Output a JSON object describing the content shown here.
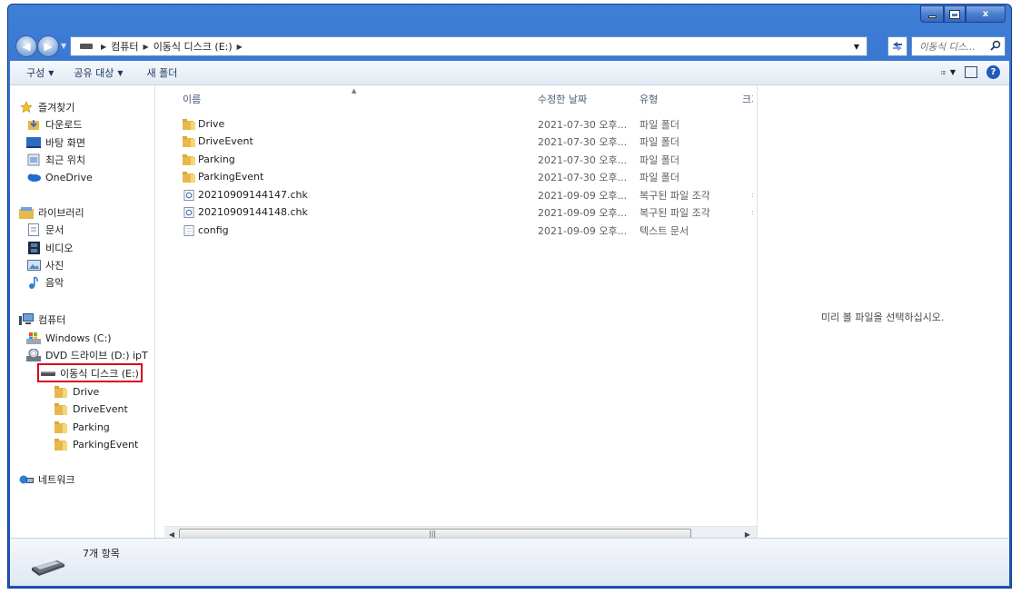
{
  "window": {
    "caption_minimize": "–",
    "caption_close": "x"
  },
  "address": {
    "crumbs": [
      "컴퓨터",
      "이동식 디스크 (E:)"
    ],
    "search_placeholder": "이동식 디스...",
    "refresh_icon": "refresh-icon"
  },
  "toolbar": {
    "organize": "구성",
    "share": "공유 대상",
    "new_folder": "새 폴더"
  },
  "nav": {
    "favorites": "즐겨찾기",
    "downloads": "다운로드",
    "desktop": "바탕 화면",
    "recent": "최근 위치",
    "onedrive": "OneDrive",
    "libraries": "라이브러리",
    "documents": "문서",
    "videos": "비디오",
    "pictures": "사진",
    "music": "음악",
    "computer": "컴퓨터",
    "windows_c": "Windows (C:)",
    "dvd_d": "DVD 드라이브 (D:) ipT",
    "removable_e": "이동식 디스크 (E:)",
    "sub": [
      "Drive",
      "DriveEvent",
      "Parking",
      "ParkingEvent"
    ],
    "network": "네트워크"
  },
  "columns": {
    "name": "이름",
    "modified": "수정한 날짜",
    "type": "유형",
    "size": "크기"
  },
  "files": [
    {
      "name": "Drive",
      "date": "2021-07-30 오후...",
      "type": "파일 폴더",
      "icon": "folder-icon"
    },
    {
      "name": "DriveEvent",
      "date": "2021-07-30 오후...",
      "type": "파일 폴더",
      "icon": "folder-icon"
    },
    {
      "name": "Parking",
      "date": "2021-07-30 오후...",
      "type": "파일 폴더",
      "icon": "folder-icon"
    },
    {
      "name": "ParkingEvent",
      "date": "2021-07-30 오후...",
      "type": "파일 폴더",
      "icon": "folder-icon"
    },
    {
      "name": "20210909144147.chk",
      "date": "2021-09-09 오후...",
      "type": "복구된 파일 조각",
      "icon": "chk-file-icon"
    },
    {
      "name": "20210909144148.chk",
      "date": "2021-09-09 오후...",
      "type": "복구된 파일 조각",
      "icon": "chk-file-icon"
    },
    {
      "name": "config",
      "date": "2021-09-09 오후...",
      "type": "텍스트 문서",
      "icon": "text-file-icon"
    }
  ],
  "preview": {
    "message": "미리 볼 파일을 선택하십시오."
  },
  "details": {
    "count": "7개 항목"
  },
  "colors": {
    "titlebar": "#2a63c4",
    "folder": "#e8b84a",
    "selection_box": "#d9001b"
  }
}
